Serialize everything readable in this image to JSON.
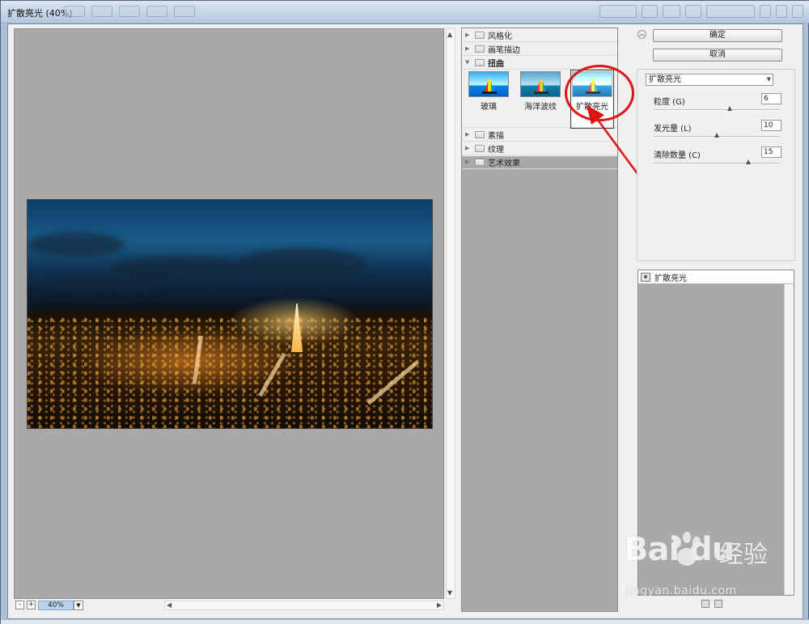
{
  "window": {
    "title": "扩散亮光 (40%)"
  },
  "preview": {
    "zoom_value": "40%",
    "zoom_minus": "-",
    "zoom_plus": "+"
  },
  "gallery": {
    "categories_top": [
      {
        "label": "风格化",
        "expanded": false
      },
      {
        "label": "画笔描边",
        "expanded": false
      },
      {
        "label": "扭曲",
        "expanded": true
      }
    ],
    "thumbnails": [
      {
        "label": "玻璃",
        "selected": false
      },
      {
        "label": "海洋波纹",
        "selected": false
      },
      {
        "label": "扩散亮光",
        "selected": true
      }
    ],
    "categories_bottom": [
      {
        "label": "素描",
        "expanded": false
      },
      {
        "label": "纹理",
        "expanded": false
      },
      {
        "label": "艺术效果",
        "expanded": false
      }
    ]
  },
  "buttons": {
    "ok": "确定",
    "cancel": "取消"
  },
  "settings": {
    "selected_filter": "扩散亮光",
    "params": [
      {
        "label": "粒度 (G)",
        "value": "6",
        "level": 0.6
      },
      {
        "label": "发光量 (L)",
        "value": "10",
        "level": 0.5
      },
      {
        "label": "清除数量 (C)",
        "value": "15",
        "level": 0.75
      }
    ]
  },
  "effects_layers": [
    {
      "label": "扩散亮光"
    }
  ],
  "watermark": {
    "logo": "Bai du",
    "cn": "经验",
    "url": "jingyan.baidu.com"
  },
  "colors": {
    "annotation": "#e01414",
    "preview_bg": "#a9a9a9",
    "zoom_highlight": "#b8d3f0"
  }
}
